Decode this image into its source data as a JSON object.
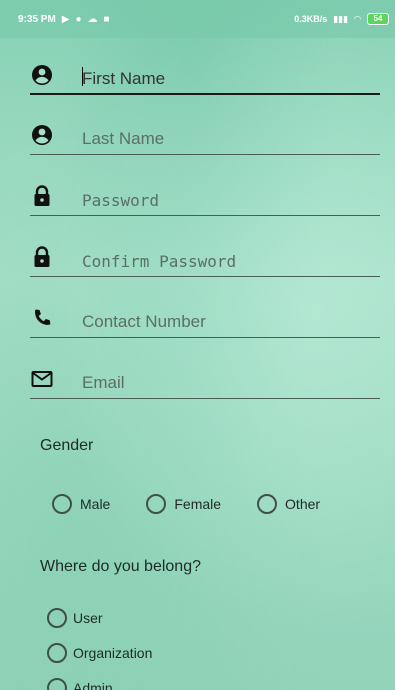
{
  "status_bar": {
    "time": "9:35 PM",
    "network_speed": "0.3KB/s",
    "battery": "54",
    "icons": [
      "play-icon",
      "chat-icon",
      "cloud-icon",
      "bag-icon",
      "signal-icon",
      "wifi-icon"
    ]
  },
  "form": {
    "first_name": {
      "placeholder": "First Name",
      "icon": "account-circle-icon"
    },
    "last_name": {
      "placeholder": "Last Name",
      "icon": "account-circle-icon"
    },
    "password": {
      "placeholder": "Password",
      "icon": "lock-icon"
    },
    "confirm_password": {
      "placeholder": "Confirm Password",
      "icon": "lock-icon"
    },
    "contact_number": {
      "placeholder": "Contact Number",
      "icon": "phone-icon"
    },
    "email": {
      "placeholder": "Email",
      "icon": "mail-icon"
    }
  },
  "gender": {
    "label": "Gender",
    "options": [
      "Male",
      "Female",
      "Other"
    ]
  },
  "belong": {
    "label": "Where do you belong?",
    "options": [
      "User",
      "Organization",
      "Admin"
    ]
  },
  "colors": {
    "background": "#a6dfc8",
    "text": "#1e2b27",
    "underline": "#4a5e58"
  }
}
